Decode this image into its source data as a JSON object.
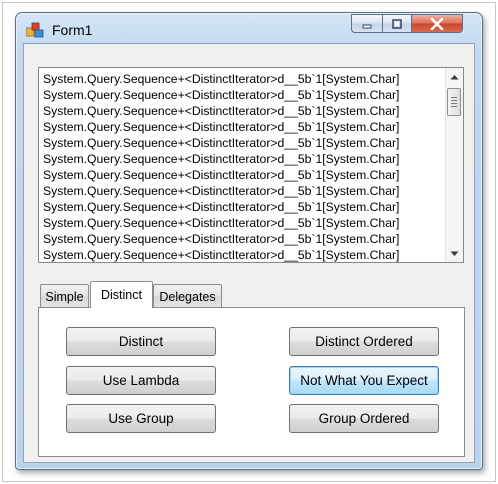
{
  "window": {
    "title": "Form1",
    "controls": {
      "minimize_icon": "minimize-icon",
      "maximize_icon": "maximize-icon",
      "close_icon": "close-icon"
    }
  },
  "listbox": {
    "items": [
      "System.Query.Sequence+<DistinctIterator>d__5b`1[System.Char]",
      "System.Query.Sequence+<DistinctIterator>d__5b`1[System.Char]",
      "System.Query.Sequence+<DistinctIterator>d__5b`1[System.Char]",
      "System.Query.Sequence+<DistinctIterator>d__5b`1[System.Char]",
      "System.Query.Sequence+<DistinctIterator>d__5b`1[System.Char]",
      "System.Query.Sequence+<DistinctIterator>d__5b`1[System.Char]",
      "System.Query.Sequence+<DistinctIterator>d__5b`1[System.Char]",
      "System.Query.Sequence+<DistinctIterator>d__5b`1[System.Char]",
      "System.Query.Sequence+<DistinctIterator>d__5b`1[System.Char]",
      "System.Query.Sequence+<DistinctIterator>d__5b`1[System.Char]",
      "System.Query.Sequence+<DistinctIterator>d__5b`1[System.Char]",
      "System.Query.Sequence+<DistinctIterator>d__5b`1[System.Char]"
    ],
    "scroll_position": 0.05
  },
  "tabs": [
    {
      "label": "Simple",
      "active": false
    },
    {
      "label": "Distinct",
      "active": true
    },
    {
      "label": "Delegates",
      "active": false
    }
  ],
  "buttons": {
    "distinct": "Distinct",
    "use_lambda": "Use Lambda",
    "use_group": "Use Group",
    "distinct_ordered": "Distinct Ordered",
    "not_what_you_expect": "Not What You Expect",
    "group_ordered": "Group Ordered"
  },
  "colors": {
    "title_bar": "#c2d8ef",
    "close_button": "#c9442c",
    "focused_button": "#3c7fb1"
  }
}
